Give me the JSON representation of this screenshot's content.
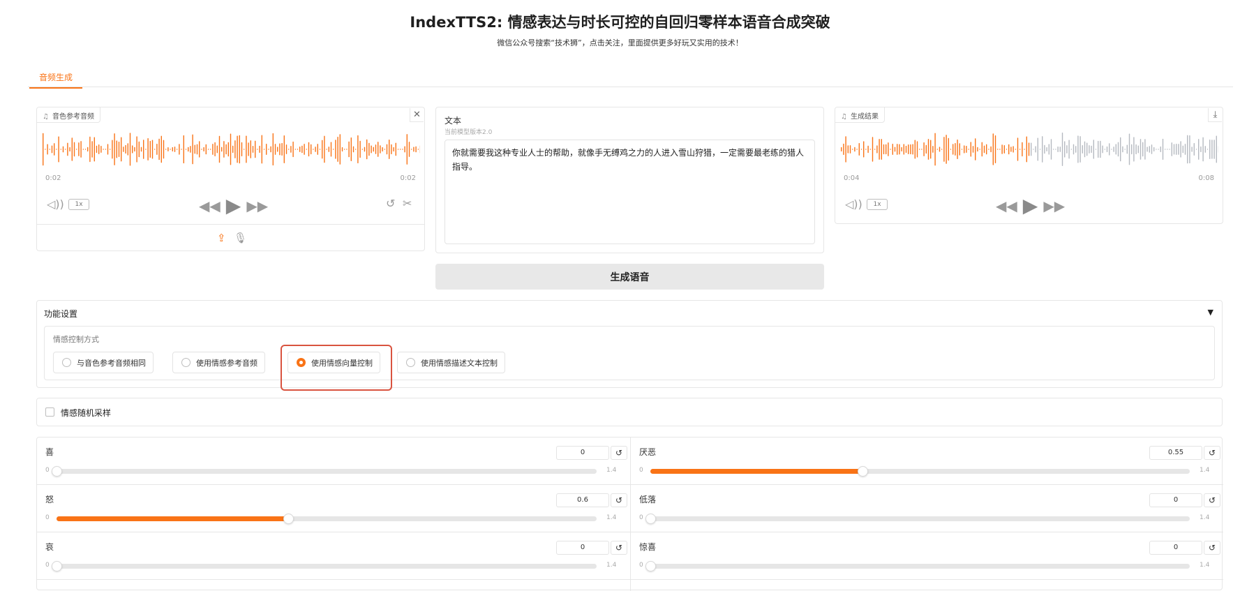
{
  "header": {
    "title": "IndexTTS2: 情感表达与时长可控的自回归零样本语音合成突破",
    "subtitle": "微信公众号搜索“技术狮”，点击关注，里面提供更多好玩又实用的技术！"
  },
  "tabs": [
    {
      "label": "音频生成"
    }
  ],
  "ref_audio": {
    "label": "音色参考音频",
    "time_current": "0:02",
    "time_total": "0:02",
    "speed": "1x",
    "close_icon": "close-icon",
    "upload_icon": "upload-icon",
    "mic_icon": "microphone-icon"
  },
  "text_panel": {
    "label": "文本",
    "info": "当前模型版本2.0",
    "value": "你就需要我这种专业人士的帮助，就像手无缚鸡之力的人进入雪山狩猎，一定需要最老练的猎人指导。"
  },
  "result_audio": {
    "label": "生成结果",
    "time_current": "0:04",
    "time_total": "0:08",
    "speed": "1x",
    "download_icon": "download-icon",
    "progress": 0.5
  },
  "generate_button": "生成语音",
  "settings": {
    "title": "功能设置",
    "emotion_label": "情感控制方式",
    "options": [
      "与音色参考音频相同",
      "使用情感参考音频",
      "使用情感向量控制",
      "使用情感描述文本控制"
    ],
    "selected": 2,
    "random_label": "情感随机采样"
  },
  "sliders": [
    {
      "label": "喜",
      "value": "0",
      "v": 0,
      "min": "0",
      "max": "1.4"
    },
    {
      "label": "厌恶",
      "value": "0.55",
      "v": 0.55,
      "min": "0",
      "max": "1.4"
    },
    {
      "label": "怒",
      "value": "0.6",
      "v": 0.6,
      "min": "0",
      "max": "1.4"
    },
    {
      "label": "低落",
      "value": "0",
      "v": 0,
      "min": "0",
      "max": "1.4"
    },
    {
      "label": "哀",
      "value": "0",
      "v": 0,
      "min": "0",
      "max": "1.4"
    },
    {
      "label": "惊喜",
      "value": "0",
      "v": 0,
      "min": "0",
      "max": "1.4"
    }
  ],
  "colors": {
    "accent": "#f97316",
    "highlight": "#d9533f",
    "wave_gray": "#b5b9c0"
  }
}
